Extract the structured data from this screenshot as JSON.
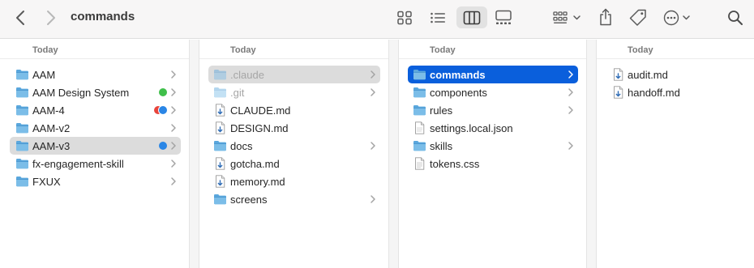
{
  "window": {
    "title": "commands"
  },
  "toolbar": {
    "icons": [
      "chevron-left-icon",
      "chevron-right-icon",
      "icon-view-grid-icon",
      "list-view-icon",
      "column-view-icon",
      "gallery-view-icon",
      "group-icon",
      "share-icon",
      "tag-icon",
      "more-icon",
      "search-icon"
    ],
    "active_view": "columns"
  },
  "colors": {
    "accent": "#0a5fdc",
    "folder": "#5aa7dd",
    "selection_grey": "#dcdcdc",
    "tag_green": "#3fbf4a",
    "tag_red": "#e8453c",
    "tag_blue": "#2a86e6"
  },
  "columns": [
    {
      "header": "Today",
      "items": [
        {
          "name": "AAM",
          "kind": "folder",
          "chevron": true
        },
        {
          "name": "AAM Design System",
          "kind": "folder",
          "chevron": true,
          "tags": [
            "#3fbf4a"
          ]
        },
        {
          "name": "AAM-4",
          "kind": "folder",
          "chevron": true,
          "tags": [
            "#e8453c",
            "#2a86e6"
          ]
        },
        {
          "name": "AAM-v2",
          "kind": "folder",
          "chevron": true
        },
        {
          "name": "AAM-v3",
          "kind": "folder",
          "chevron": true,
          "tags": [
            "#2a86e6"
          ],
          "selected": "grey"
        },
        {
          "name": "fx-engagement-skill",
          "kind": "folder",
          "chevron": true
        },
        {
          "name": "FXUX",
          "kind": "folder",
          "chevron": true
        }
      ]
    },
    {
      "header": "Today",
      "items": [
        {
          "name": ".claude",
          "kind": "folder",
          "chevron": true,
          "dim": true,
          "selected": "grey"
        },
        {
          "name": ".git",
          "kind": "folder",
          "chevron": true,
          "dim": true
        },
        {
          "name": "CLAUDE.md",
          "kind": "markdown"
        },
        {
          "name": "DESIGN.md",
          "kind": "markdown"
        },
        {
          "name": "docs",
          "kind": "folder",
          "chevron": true
        },
        {
          "name": "gotcha.md",
          "kind": "markdown"
        },
        {
          "name": "memory.md",
          "kind": "markdown"
        },
        {
          "name": "screens",
          "kind": "folder",
          "chevron": true
        }
      ]
    },
    {
      "header": "Today",
      "items": [
        {
          "name": "commands",
          "kind": "folder",
          "chevron": true,
          "selected": "blue"
        },
        {
          "name": "components",
          "kind": "folder",
          "chevron": true
        },
        {
          "name": "rules",
          "kind": "folder",
          "chevron": true
        },
        {
          "name": "settings.local.json",
          "kind": "document"
        },
        {
          "name": "skills",
          "kind": "folder",
          "chevron": true
        },
        {
          "name": "tokens.css",
          "kind": "css"
        }
      ]
    },
    {
      "header": "Today",
      "items": [
        {
          "name": "audit.md",
          "kind": "markdown"
        },
        {
          "name": "handoff.md",
          "kind": "markdown"
        }
      ]
    }
  ]
}
